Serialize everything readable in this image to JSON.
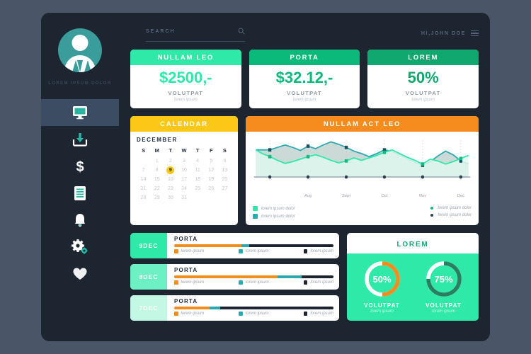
{
  "theme": {
    "page_bg": "#4a5668",
    "panel_bg": "#1d2530",
    "accent_mint": "#2ee9a8",
    "accent_green": "#0bb97b",
    "accent_green_dark": "#11a86f",
    "accent_yellow": "#fcc817",
    "accent_orange": "#f68b1e",
    "accent_teal": "#2aa9b0",
    "accent_dark": "#1d2530"
  },
  "sidebar": {
    "avatar_name": "LOREM IPSUM DOLOR",
    "items": [
      {
        "icon": "monitor-icon",
        "name": "dashboard",
        "active": true
      },
      {
        "icon": "download-icon",
        "name": "downloads",
        "active": false
      },
      {
        "icon": "dollar-icon",
        "name": "billing",
        "active": false
      },
      {
        "icon": "document-icon",
        "name": "documents",
        "active": false
      },
      {
        "icon": "bell-icon",
        "name": "notifications",
        "active": false
      },
      {
        "icon": "gear-icon",
        "name": "settings",
        "active": false
      },
      {
        "icon": "heart-icon",
        "name": "favorites",
        "active": false
      }
    ]
  },
  "topbar": {
    "search_label": "SEARCH",
    "search_placeholder": "SEARCH",
    "search_value": "",
    "search_icon": "magnifier-icon",
    "user_greeting": "HI,JOHN DOE",
    "menu_icon": "hamburger-menu-icon"
  },
  "kpis": [
    {
      "title": "NULLAM LEO",
      "value": "$2500,-",
      "sub": "VOLUTPAT",
      "sub2": "lorem ipsum",
      "head_color": "#2ee9a8",
      "value_color": "#2ee9a8"
    },
    {
      "title": "PORTA",
      "value": "$32.12,-",
      "sub": "VOLUTPAT",
      "sub2": "lorem ipsum",
      "head_color": "#0bb97b",
      "value_color": "#0bb97b"
    },
    {
      "title": "LOREM",
      "value": "50%",
      "sub": "VOLUTPAT",
      "sub2": "lorem ipsum",
      "head_color": "#11a86f",
      "value_color": "#11a86f"
    }
  ],
  "calendar": {
    "title": "CALENDAR",
    "month": "DECEMBER",
    "weekdays": [
      "S",
      "M",
      "T",
      "W",
      "T",
      "F",
      "S"
    ],
    "leading_blanks": 1,
    "days": [
      1,
      2,
      3,
      4,
      5,
      6,
      7,
      8,
      9,
      10,
      11,
      12,
      13,
      14,
      15,
      16,
      17,
      18,
      19,
      20,
      21,
      22,
      23,
      24,
      25,
      26,
      27,
      28,
      29,
      30,
      31
    ],
    "today": 9
  },
  "chart_card": {
    "title": "NULLAM ACT LEO",
    "legend_left": [
      {
        "label": "lorem ipsum dolor",
        "color": "#2ee9a8",
        "shape": "square"
      },
      {
        "label": "lorem ipsum dolor",
        "color": "#2aa9b0",
        "shape": "square"
      }
    ],
    "legend_right": [
      {
        "label": "lorem ipsum dolor",
        "color": "#0bb97b",
        "shape": "dot"
      },
      {
        "label": "lorem ipsum dolor",
        "color": "#2d3e52",
        "shape": "dot"
      }
    ]
  },
  "chart_data": {
    "type": "area",
    "title": "NULLAM ACT LEO",
    "xlabel": "",
    "ylabel": "",
    "grid": false,
    "legend_position": "bottom",
    "tick_labels": [
      "",
      "Aug",
      "Sept",
      "Oct",
      "Nov",
      "Dec"
    ],
    "tick_x": [
      22,
      82,
      142,
      202,
      262,
      322
    ],
    "x": [
      0,
      10,
      22,
      34,
      46,
      58,
      70,
      82,
      94,
      106,
      118,
      130,
      142,
      154,
      166,
      178,
      190,
      202,
      214,
      226,
      238,
      250,
      262,
      274,
      286,
      298,
      310,
      322,
      334
    ],
    "ylim": [
      0,
      62
    ],
    "series": [
      {
        "name": "lorem ipsum dolor",
        "color": "#2aa9b0",
        "fill": "#b9cdc9",
        "values": [
          44,
          44,
          44,
          48,
          52,
          48,
          43,
          50,
          46,
          52,
          57,
          53,
          48,
          42,
          38,
          33,
          38,
          44,
          41,
          36,
          30,
          24,
          19,
          25,
          34,
          42,
          36,
          26,
          21
        ]
      },
      {
        "name": "lorem ipsum dolor",
        "color": "#2ee9a8",
        "fill": "#dff7ee",
        "values": [
          44,
          38,
          33,
          27,
          22,
          25,
          29,
          33,
          36,
          32,
          27,
          23,
          26,
          31,
          27,
          31,
          35,
          40,
          44,
          38,
          32,
          27,
          21,
          29,
          26,
          21,
          25,
          30,
          35
        ]
      }
    ],
    "markers": {
      "series_0_at_ticks": [
        44,
        48,
        44,
        44,
        24,
        21
      ],
      "series_1_at_ticks": [
        44,
        33,
        31,
        44,
        27,
        35
      ]
    }
  },
  "list_rows": [
    {
      "date": "9DEC",
      "title": "PORTA",
      "date_bg": "#2ee9a8",
      "date_color": "#ffffff",
      "segments": [
        42,
        5
      ],
      "legend": [
        "lorem ipsum",
        "lorem ipsum",
        "lorem ipsum"
      ]
    },
    {
      "date": "8DEC",
      "title": "PORTA",
      "date_bg": "#6df0c4",
      "date_color": "#ffffff",
      "segments": [
        65,
        15
      ],
      "legend": [
        "lorem ipsum",
        "lorem ipsum",
        "lorem ipsum"
      ]
    },
    {
      "date": "7DEC",
      "title": "PORTA",
      "date_bg": "#c2f8e4",
      "date_color": "#ffffff",
      "segments": [
        22,
        7
      ],
      "legend": [
        "lorem ipsum",
        "lorem ipsum",
        "lorem ipsum"
      ]
    }
  ],
  "donut_card": {
    "title": "LOREM",
    "gauges": [
      {
        "value": 50,
        "label": "50%",
        "cap": "VOLUTPAT",
        "cap2": "lorem ipsum",
        "arc_color": "#f68b1e",
        "track_color": "#ffffff"
      },
      {
        "value": 75,
        "label": "75%",
        "cap": "VOLUTPAT",
        "cap2": "lorem ipsum",
        "arc_color": "#2a7f62",
        "track_color": "#ffffff"
      }
    ]
  }
}
